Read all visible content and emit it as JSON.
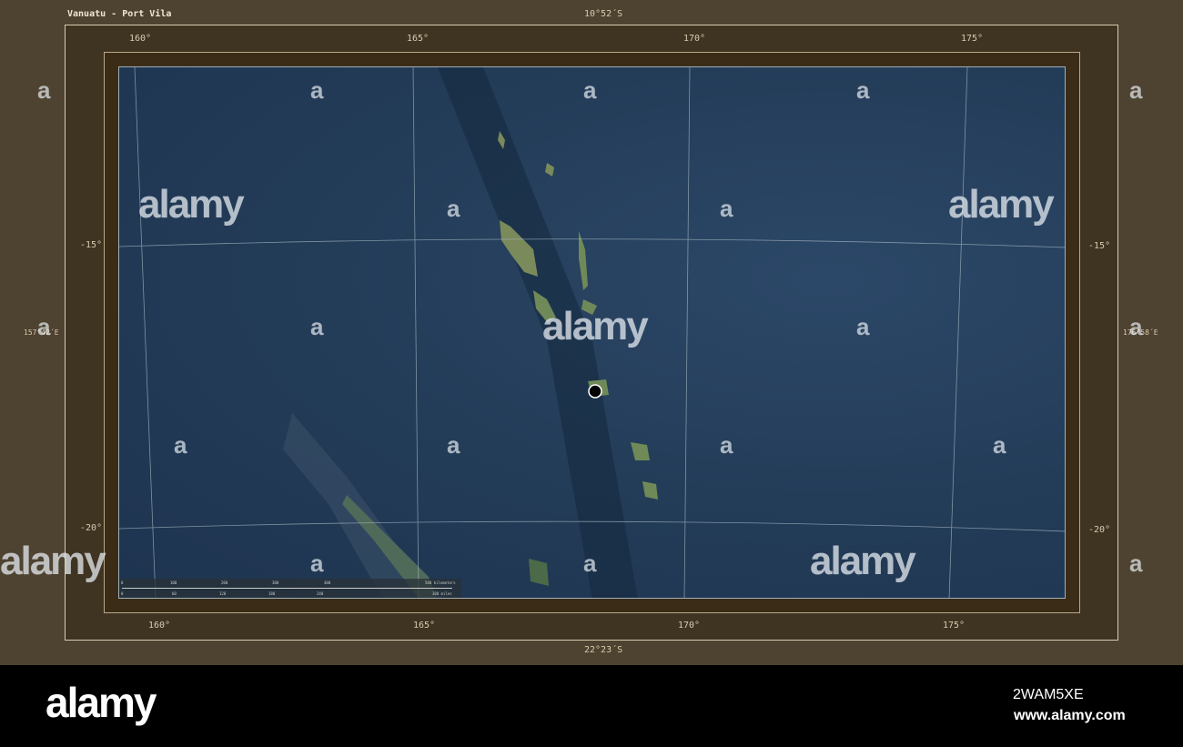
{
  "title": "Vanuatu - Port Vila",
  "extent": {
    "north": "10°52´S",
    "south": "22°23´S",
    "west": "157°42´E",
    "east": "176°58´E"
  },
  "lon_labels": [
    "160°",
    "165°",
    "170°",
    "175°"
  ],
  "lat_labels": [
    "-15°",
    "-20°"
  ],
  "scale": {
    "km": [
      "0",
      "100",
      "200",
      "300",
      "400",
      "500 kilometers"
    ],
    "mi": [
      "0",
      "60",
      "120",
      "180",
      "240",
      "300 miles"
    ]
  },
  "marker": {
    "name": "Port Vila",
    "color": "#000000"
  },
  "watermark": {
    "tile": "a",
    "word": "alamy"
  },
  "footer": {
    "logo": "alamy",
    "image_id": "2WAM5XE",
    "url": "www.alamy.com"
  }
}
